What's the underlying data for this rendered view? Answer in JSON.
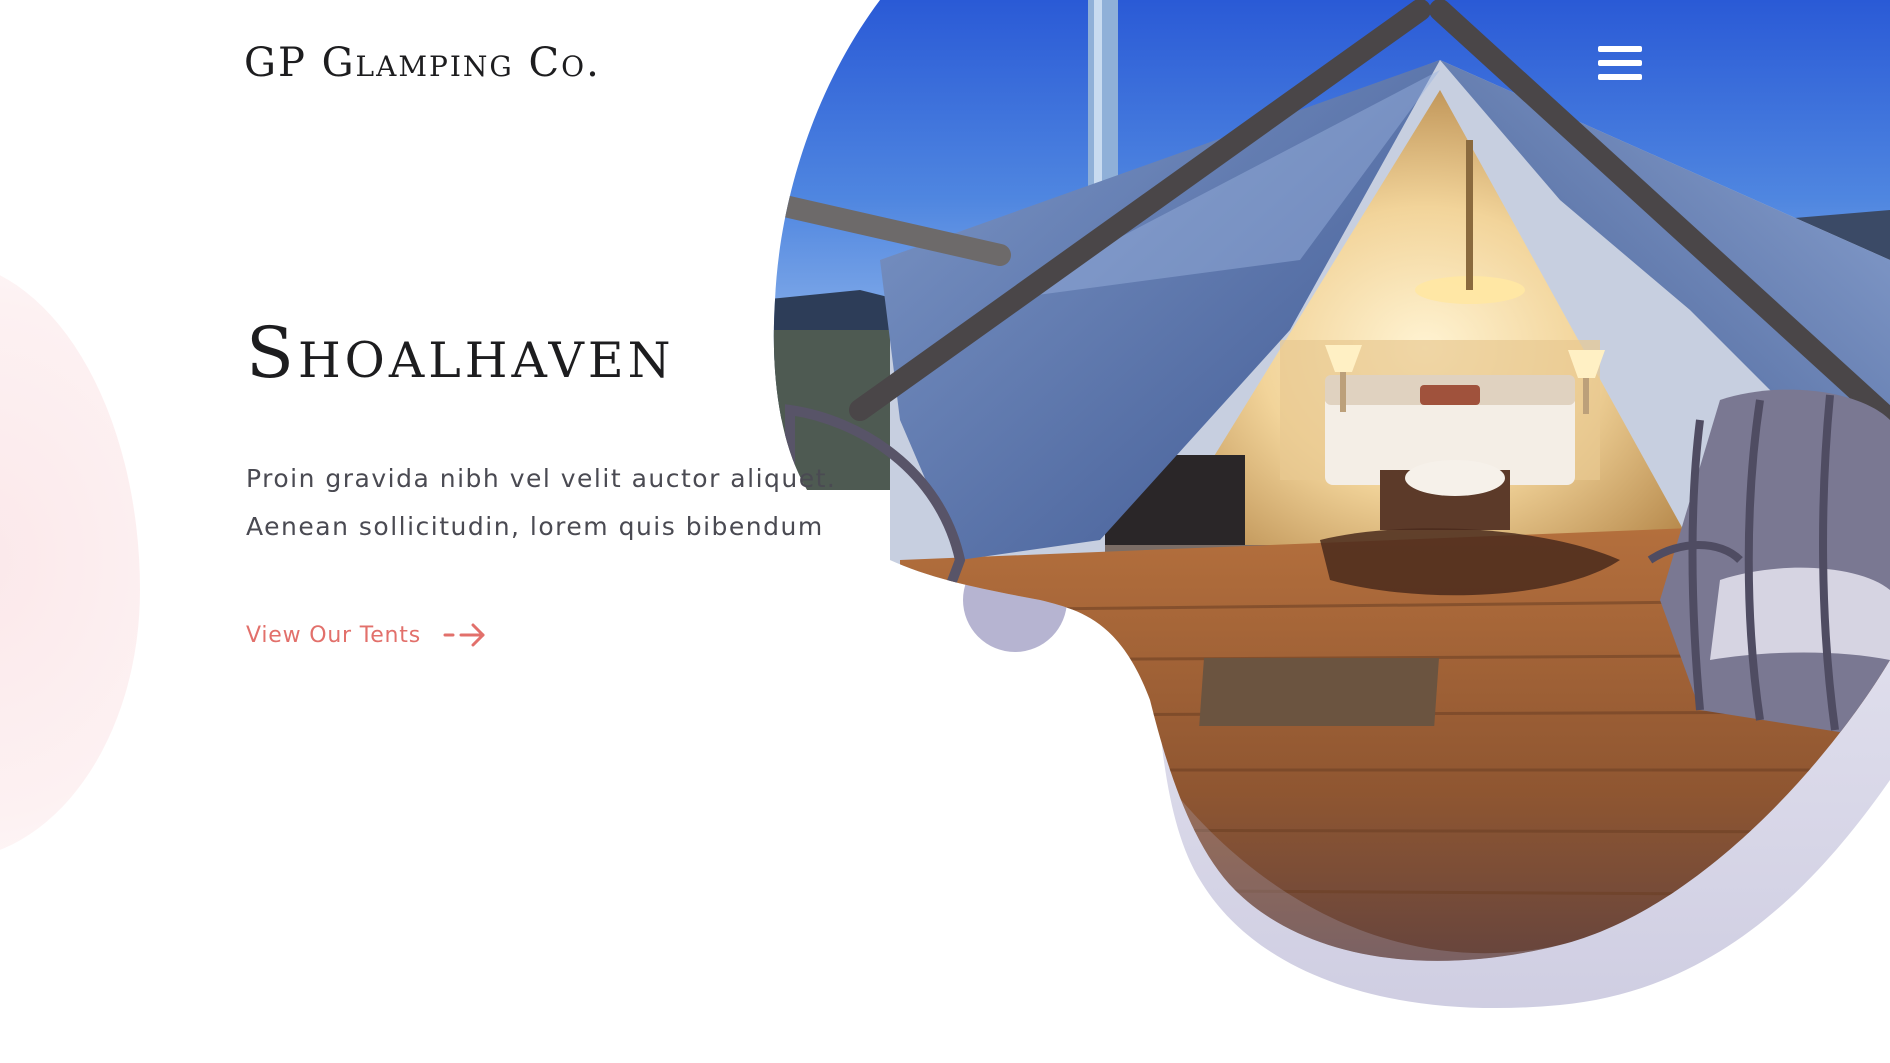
{
  "header": {
    "brand": "GP Glamping Co.",
    "menu_icon": "hamburger-menu-icon"
  },
  "hero": {
    "title": "Shoalhaven",
    "description_lines": [
      "Proin gravida nibh vel velit auctor aliquet.",
      "Aenean sollicitudin, lorem quis bibendum"
    ],
    "cta_label": "View Our Tents",
    "cta_icon": "arrow-right-icon",
    "image_icon": "glamping-tent-photo"
  },
  "colors": {
    "accent": "#e2706b",
    "heading": "#1d1d1f",
    "body_text": "#4a4a52",
    "blob_lavender": "#b8b6d4",
    "blob_pink": "#fbe8ea",
    "menu_icon": "#ffffff"
  }
}
